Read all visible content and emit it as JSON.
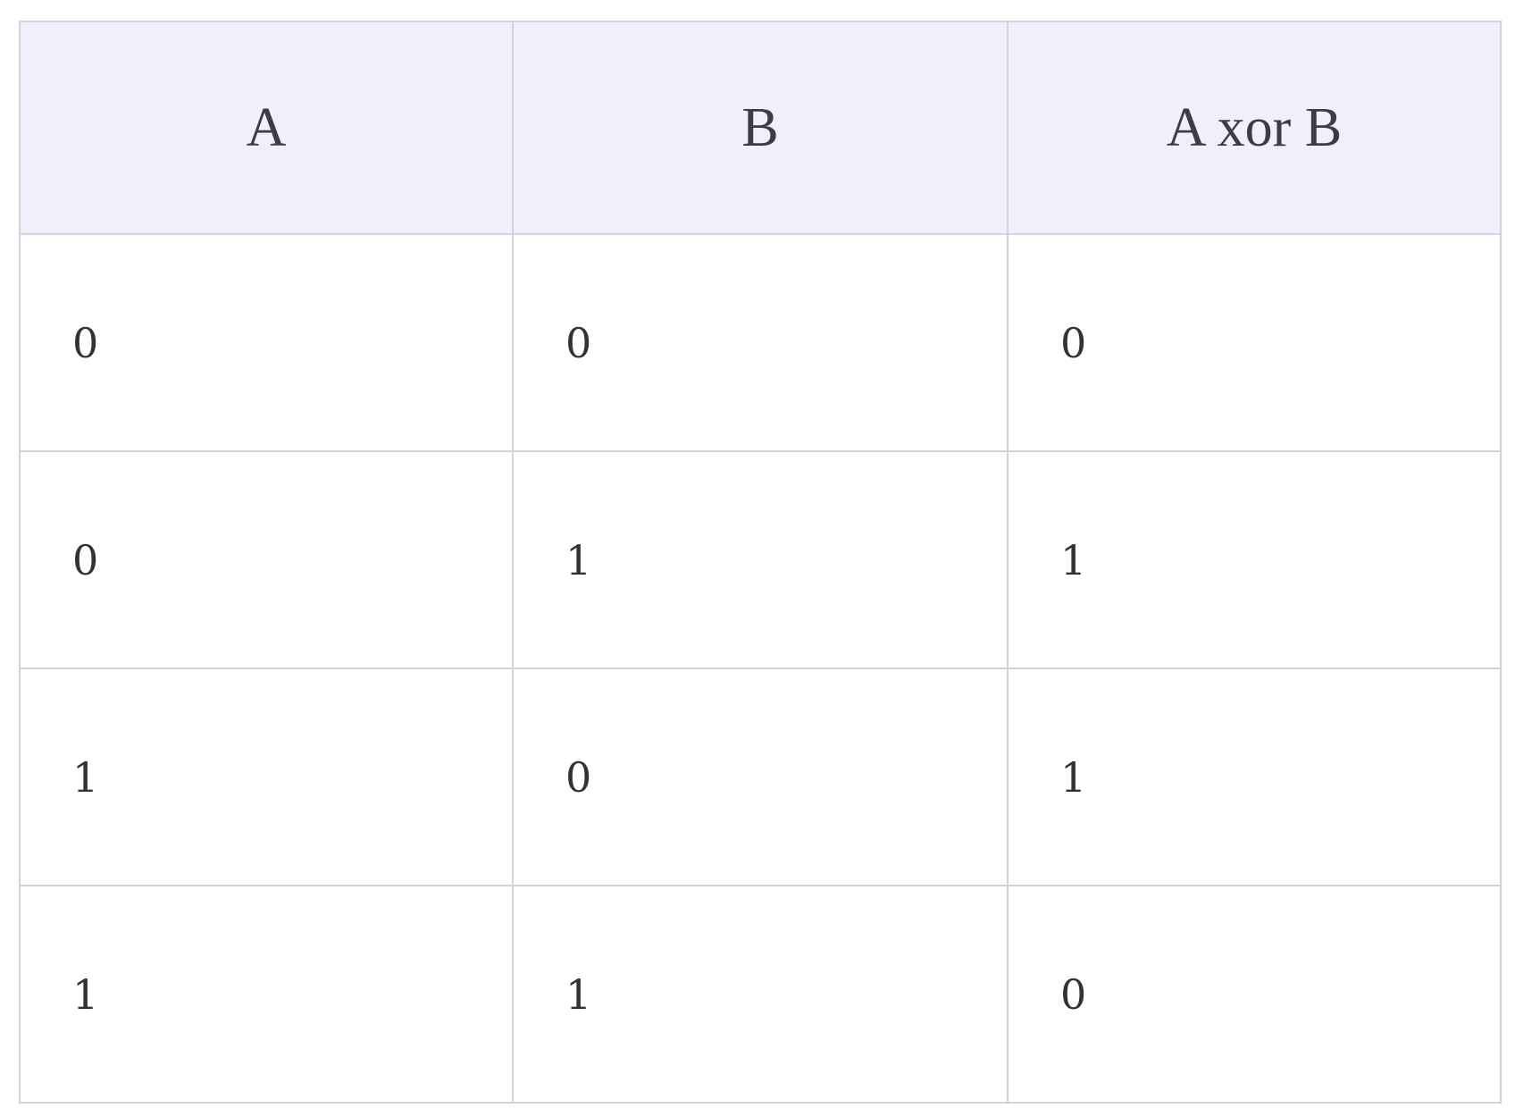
{
  "table": {
    "headers": [
      "A",
      "B",
      "A xor B"
    ],
    "rows": [
      [
        "0",
        "0",
        "0"
      ],
      [
        "0",
        "1",
        "1"
      ],
      [
        "1",
        "0",
        "1"
      ],
      [
        "1",
        "1",
        "0"
      ]
    ]
  },
  "colors": {
    "header_background": "#f0f0fc",
    "border": "#d4d4d8",
    "text": "#333333"
  }
}
